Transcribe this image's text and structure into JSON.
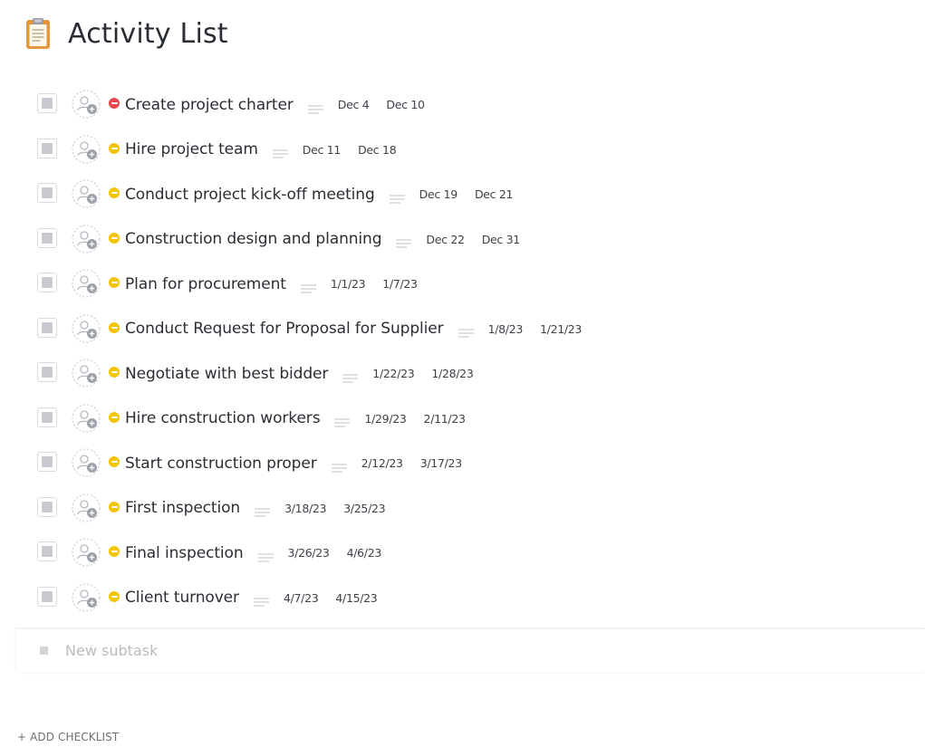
{
  "header": {
    "title": "Activity List",
    "icon": "clipboard-icon"
  },
  "colors": {
    "priority_urgent": "#e5484d",
    "priority_high": "#f5c400"
  },
  "tasks": [
    {
      "name": "Create project charter",
      "start": "Dec 4",
      "due": "Dec 10",
      "priority": "urgent"
    },
    {
      "name": "Hire project team",
      "start": "Dec 11",
      "due": "Dec 18",
      "priority": "high"
    },
    {
      "name": "Conduct project kick-off meeting",
      "start": "Dec 19",
      "due": "Dec 21",
      "priority": "high"
    },
    {
      "name": "Construction design and planning",
      "start": "Dec 22",
      "due": "Dec 31",
      "priority": "high"
    },
    {
      "name": "Plan for procurement",
      "start": "1/1/23",
      "due": "1/7/23",
      "priority": "high"
    },
    {
      "name": "Conduct Request for Proposal for Supplier",
      "start": "1/8/23",
      "due": "1/21/23",
      "priority": "high"
    },
    {
      "name": "Negotiate with best bidder",
      "start": "1/22/23",
      "due": "1/28/23",
      "priority": "high"
    },
    {
      "name": "Hire construction workers",
      "start": "1/29/23",
      "due": "2/11/23",
      "priority": "high"
    },
    {
      "name": "Start construction proper",
      "start": "2/12/23",
      "due": "3/17/23",
      "priority": "high"
    },
    {
      "name": "First inspection",
      "start": "3/18/23",
      "due": "3/25/23",
      "priority": "high"
    },
    {
      "name": "Final inspection",
      "start": "3/26/23",
      "due": "4/6/23",
      "priority": "high"
    },
    {
      "name": "Client turnover",
      "start": "4/7/23",
      "due": "4/15/23",
      "priority": "high"
    }
  ],
  "new_subtask": {
    "placeholder": "New subtask"
  },
  "footer": {
    "add_checklist_label": "+ ADD CHECKLIST"
  }
}
